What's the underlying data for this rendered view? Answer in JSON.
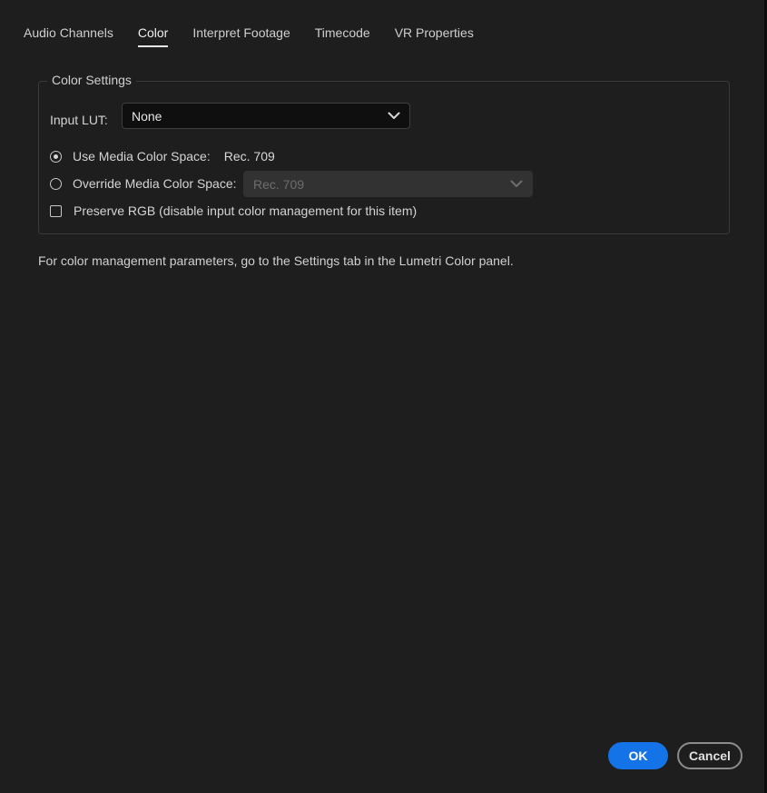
{
  "tabs": [
    {
      "label": "Audio Channels",
      "active": false
    },
    {
      "label": "Color",
      "active": true
    },
    {
      "label": "Interpret Footage",
      "active": false
    },
    {
      "label": "Timecode",
      "active": false
    },
    {
      "label": "VR Properties",
      "active": false
    }
  ],
  "color_settings": {
    "legend": "Color Settings",
    "input_lut": {
      "label": "Input LUT:",
      "value": "None"
    },
    "use_media": {
      "label": "Use Media Color Space:",
      "value": "Rec. 709",
      "checked": true
    },
    "override_media": {
      "label": "Override Media Color Space:",
      "value": "Rec. 709",
      "checked": false,
      "enabled": false
    },
    "preserve_rgb": {
      "label": "Preserve RGB (disable input color management for this item)",
      "checked": false
    }
  },
  "info_text": "For color management parameters, go to the Settings tab in the Lumetri Color panel.",
  "buttons": {
    "ok": "OK",
    "cancel": "Cancel"
  },
  "colors": {
    "background": "#1e1e1e",
    "accent": "#1473e6"
  }
}
